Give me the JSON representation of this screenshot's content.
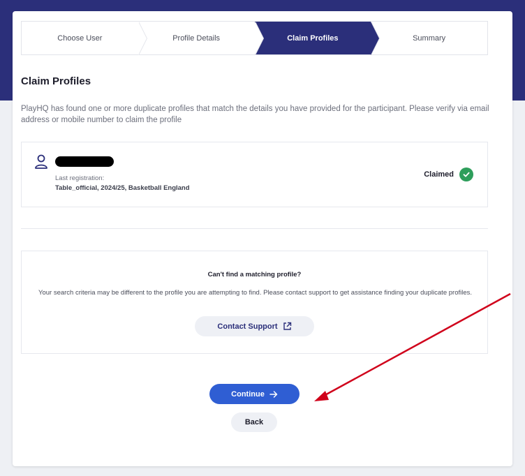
{
  "stepper": {
    "steps": [
      "Choose User",
      "Profile Details",
      "Claim Profiles",
      "Summary"
    ],
    "active_index": 2
  },
  "page": {
    "title": "Claim Profiles",
    "description": "PlayHQ has found one or more duplicate profiles that match the details you have provided for the participant. Please verify via email address or mobile number to claim the profile"
  },
  "profile": {
    "icon": "user-icon",
    "last_registration_label": "Last registration:",
    "last_registration_value": "Table_official, 2024/25, Basketball England",
    "status": "Claimed",
    "status_icon": "check-circle-icon"
  },
  "help": {
    "title": "Can't find a matching profile?",
    "text": "Your search criteria may be different to the profile you are attempting to find. Please contact support to get assistance finding your duplicate profiles.",
    "contact_label": "Contact Support",
    "contact_icon": "external-link-icon"
  },
  "actions": {
    "continue_label": "Continue",
    "continue_icon": "arrow-right-icon",
    "back_label": "Back"
  },
  "colors": {
    "brand_navy": "#2b2f7a",
    "primary_blue": "#2f5ed3",
    "success_green": "#2e9e5b",
    "annotation_red": "#d0021b"
  }
}
